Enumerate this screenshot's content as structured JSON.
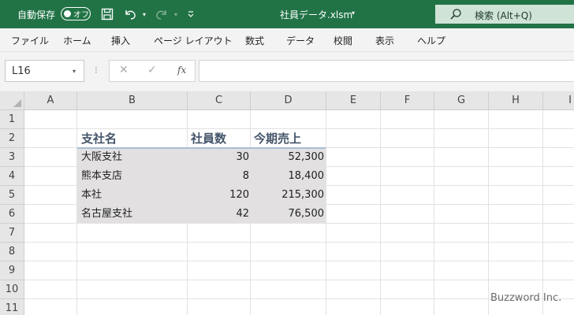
{
  "titlebar": {
    "autosave_label": "自動保存",
    "toggle_state": "オフ",
    "file_title": "社員データ.xlsm",
    "search_placeholder": "検索 (Alt+Q)",
    "accent_color": "#217346"
  },
  "menu": [
    "ファイル",
    "ホーム",
    "挿入",
    "ページ レイアウト",
    "数式",
    "データ",
    "校閲",
    "表示",
    "ヘルプ"
  ],
  "formula_bar": {
    "name_box": "L16",
    "fx_label": "fx",
    "formula": ""
  },
  "grid": {
    "columns": [
      "A",
      "B",
      "C",
      "D",
      "E",
      "F",
      "G",
      "H",
      "I"
    ],
    "rows": [
      "1",
      "2",
      "3",
      "4",
      "5",
      "6",
      "7",
      "8",
      "9",
      "10",
      "11"
    ],
    "table": {
      "headers": [
        "支社名",
        "社員数",
        "今期売上"
      ],
      "rows": [
        [
          "大阪支社",
          "30",
          "52,300"
        ],
        [
          "熊本支店",
          "8",
          "18,400"
        ],
        [
          "本社",
          "120",
          "215,300"
        ],
        [
          "名古屋支社",
          "42",
          "76,500"
        ]
      ]
    }
  },
  "watermark": "Buzzword Inc."
}
